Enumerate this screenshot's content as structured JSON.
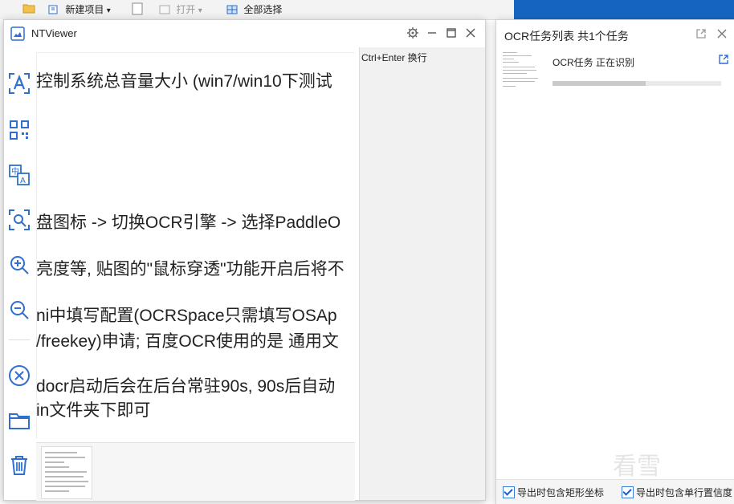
{
  "background": {
    "toolbar": {
      "new_item": "新建项目",
      "new_item_arrow": "▾",
      "open": "打开",
      "open_arrow": "▾",
      "select_all": "全部选择"
    }
  },
  "ntviewer": {
    "title": "NTViewer",
    "hint": "Ctrl+Enter 换行",
    "preview_lines": [
      "控制系统总音量大小 (win7/win10下测试",
      "盘图标 -> 切换OCR引擎 -> 选择PaddleO",
      "亮度等, 贴图的\"鼠标穿透\"功能开启后将不",
      "ni中填写配置(OCRSpace只需填写OSAp",
      "/freekey)申请; 百度OCR使用的是 通用文",
      "docr启动后会在后台常驻90s, 90s后自动",
      "in文件夹下即可"
    ],
    "sidebar_icons": [
      "ocr-text-icon",
      "qrcode-icon",
      "translate-icon",
      "screenshot-icon",
      "zoom-in-icon",
      "zoom-out-icon",
      "close-circle-icon",
      "folder-icon",
      "trash-icon"
    ]
  },
  "ocr_panel": {
    "title": "OCR任务列表 共1个任务",
    "task_name": "OCR任务 正在识别",
    "task_progress": 0.55,
    "footer": {
      "export_rect_label": "导出时包含矩形坐标",
      "export_conf_label": "导出时包含单行置信度"
    }
  },
  "watermark": "看雪",
  "colors": {
    "accent": "#2f6fd0",
    "bluebar": "#1565c0",
    "text_panel_bg": "#f1f1f1"
  }
}
